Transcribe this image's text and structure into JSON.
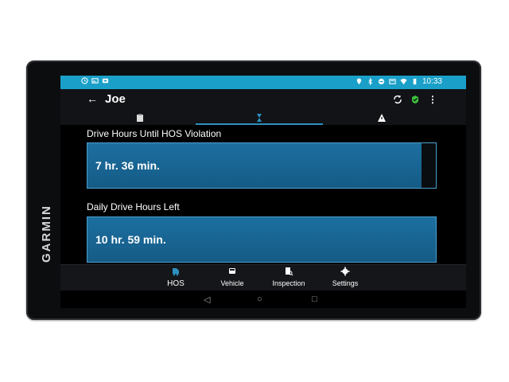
{
  "brand": "GARMIN",
  "status": {
    "time": "10:33",
    "icons_left": [
      "hourglass-icon",
      "image-icon",
      "truck-icon"
    ],
    "icons_right": [
      "location-icon",
      "bluetooth-icon",
      "minus-circle-icon",
      "cast-icon",
      "wifi-icon",
      "battery-icon"
    ]
  },
  "appbar": {
    "title": "Joe",
    "back_icon": "arrow-left-icon",
    "actions": [
      "sync-icon",
      "status-check-icon",
      "more-vert-icon"
    ]
  },
  "tabs": {
    "items": [
      "clipboard-icon",
      "hourglass-icon",
      "warning-icon"
    ],
    "active_index": 1
  },
  "main": {
    "sections": [
      {
        "label": "Drive Hours Until HOS Violation",
        "value": "7 hr. 36 min.",
        "fill_percent": 96
      },
      {
        "label": "Daily Drive Hours Left",
        "value": "10 hr. 59 min.",
        "fill_percent": 100
      }
    ]
  },
  "bottom_nav": {
    "items": [
      {
        "label": "HOS",
        "icon": "truck-hos-icon",
        "active": true
      },
      {
        "label": "Vehicle",
        "icon": "vehicle-icon",
        "active": false
      },
      {
        "label": "Inspection",
        "icon": "inspection-icon",
        "active": false
      },
      {
        "label": "Settings",
        "icon": "gear-icon",
        "active": false
      }
    ]
  },
  "system_nav": {
    "back": "◁",
    "home": "○",
    "recents": "□"
  },
  "colors": {
    "status_bar": "#1aa0c8",
    "bar_fill": "#155b86",
    "accent": "#2c91c0"
  }
}
